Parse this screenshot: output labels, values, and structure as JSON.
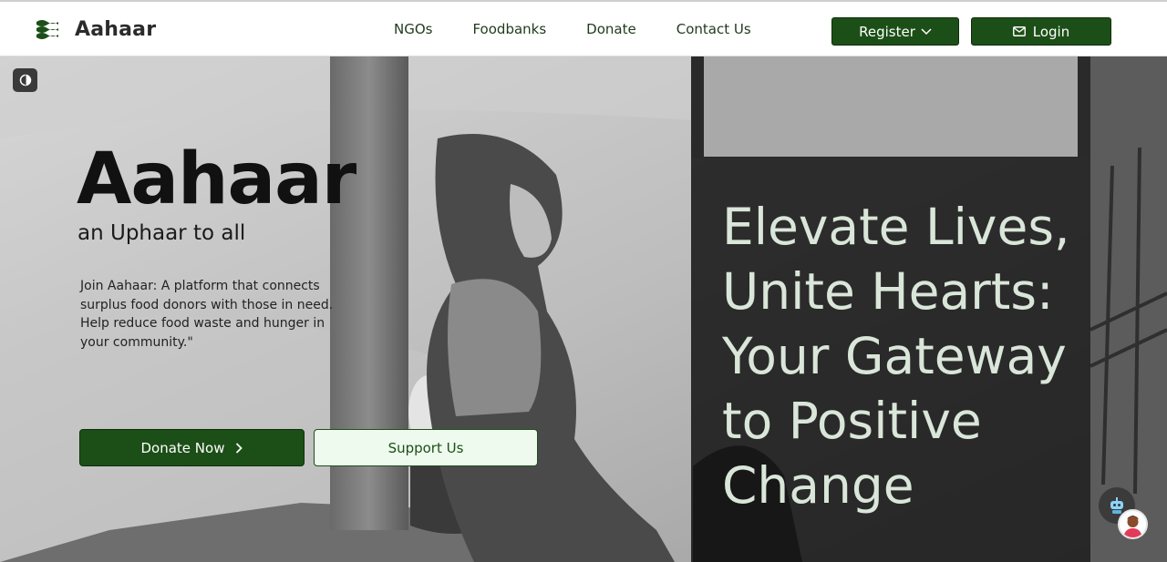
{
  "brand": {
    "name": "Aahaar",
    "icon": "flag-stripes-icon"
  },
  "nav": {
    "links": [
      "NGOs",
      "Foodbanks",
      "Donate",
      "Contact Us"
    ],
    "register_label": "Register",
    "login_label": "Login"
  },
  "hero": {
    "title": "Aahaar",
    "subtitle": "an Uphaar to all",
    "description": "Join Aahaar: A platform that connects surplus food donors with those in need. Help reduce food waste and hunger in your community.\"",
    "donate_label": "Donate Now",
    "support_label": "Support Us",
    "tagline": "Elevate Lives, Unite Hearts: Your Gateway to Positive Change"
  },
  "colors": {
    "brand_green": "#1c4f17",
    "support_bg": "#eefaee",
    "tagline_text": "#d9e6d9",
    "tagline_panel": "#141414"
  },
  "icons": {
    "register": "chevron-down-icon",
    "login": "mail-icon",
    "donate": "chevron-right-icon",
    "toggle": "contrast-toggle-icon",
    "chat": "chatbot-icon",
    "avatar": "user-avatar-icon"
  }
}
